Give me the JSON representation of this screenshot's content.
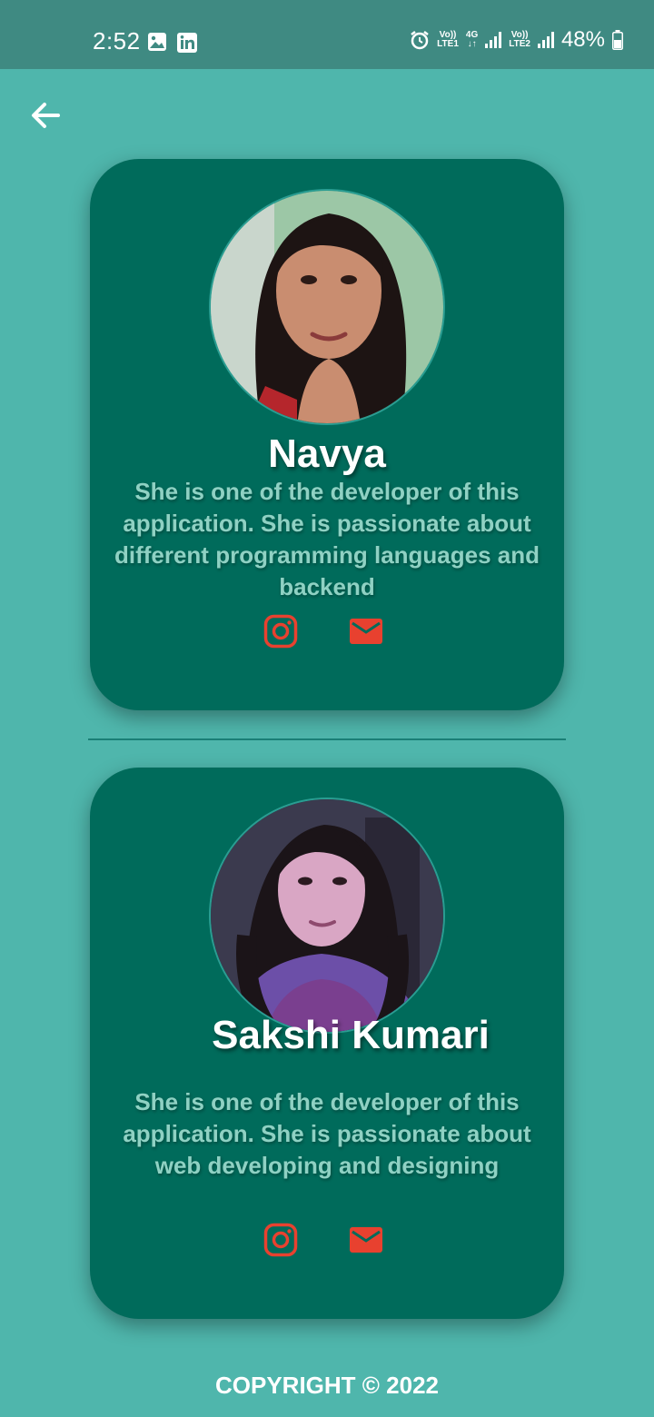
{
  "status_bar": {
    "time": "2:52",
    "icons_left": [
      "gallery-icon",
      "linkedin-icon"
    ],
    "icons_right": [
      "alarm-icon",
      "volte1-icon",
      "4g-icon",
      "signal-icon",
      "volte2-icon",
      "signal-icon",
      "battery-icon"
    ],
    "volte1_top": "Vo))",
    "volte1_bottom": "LTE1",
    "net_type": "4G",
    "volte2_top": "Vo))",
    "volte2_bottom": "LTE2",
    "battery": "48%"
  },
  "toolbar": {
    "back_icon": "arrow-left-icon"
  },
  "developers": [
    {
      "name": "Navya",
      "description": "She is one of the developer of this application. She is passionate about different programming languages and backend",
      "social": [
        "instagram-icon",
        "mail-icon"
      ]
    },
    {
      "name": "Sakshi Kumari",
      "description": "She is one of the developer of this application. She is passionate about web developing and designing",
      "social": [
        "instagram-icon",
        "mail-icon"
      ]
    }
  ],
  "footer": {
    "copyright": "COPYRIGHT © 2022"
  },
  "colors": {
    "background": "#4fb6ac",
    "status_bar": "#3f8a82",
    "card": "#006b5b",
    "description_text": "#8fd1c3",
    "icon_accent": "#e8412f"
  }
}
